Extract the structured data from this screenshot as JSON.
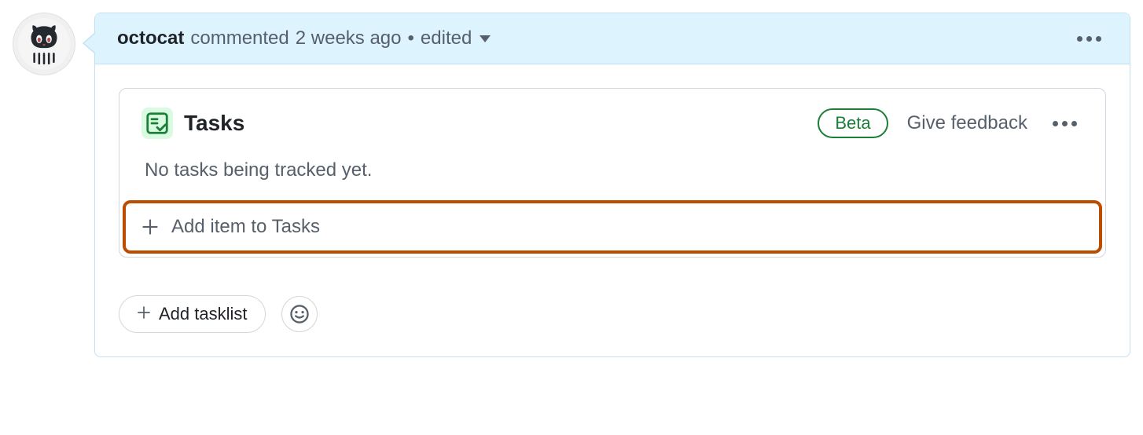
{
  "comment": {
    "author": "octocat",
    "action_text": "commented",
    "timestamp": "2 weeks ago",
    "separator": "•",
    "edited_label": "edited"
  },
  "tasks": {
    "title": "Tasks",
    "badge": "Beta",
    "feedback_label": "Give feedback",
    "empty_message": "No tasks being tracked yet.",
    "add_item_label": "Add item to Tasks"
  },
  "footer": {
    "add_tasklist_label": "Add tasklist"
  }
}
